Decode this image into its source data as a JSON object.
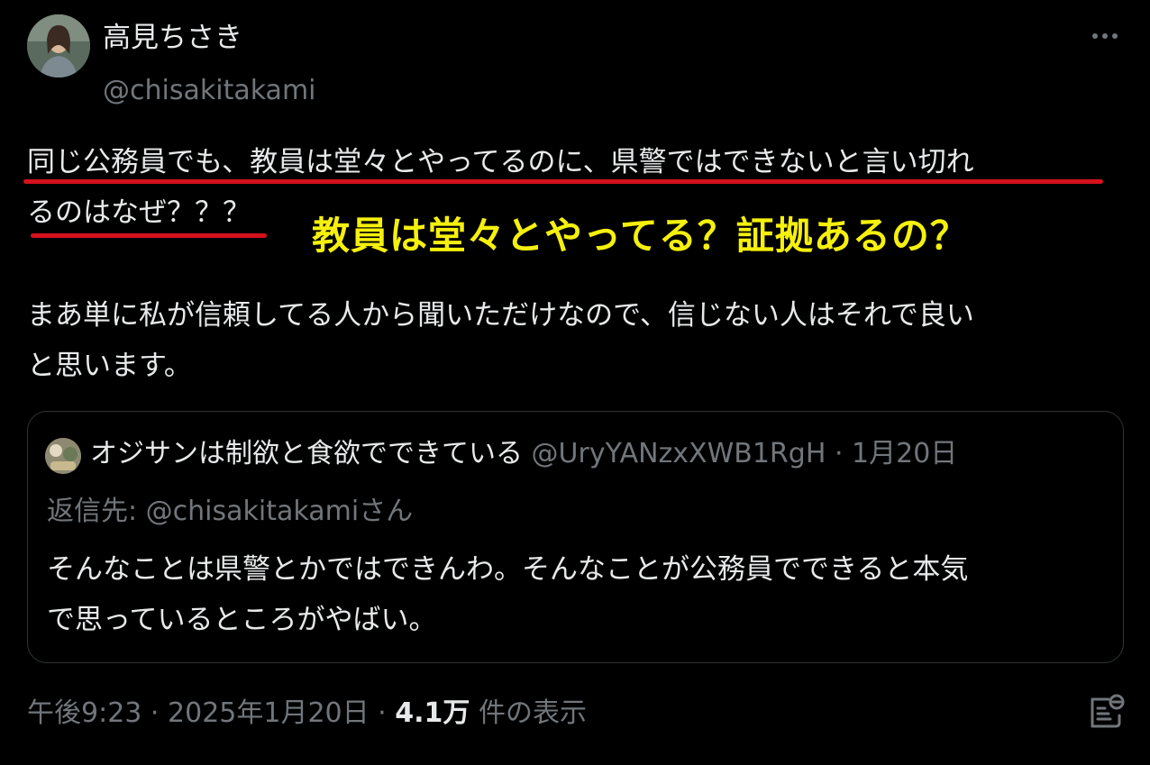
{
  "author": {
    "display_name": "高見ちさき",
    "handle": "@chisakitakami",
    "avatar_icon": "avatar-photo",
    "more_icon": "more-options-icon"
  },
  "tweet": {
    "lines": [
      "同じ公務員でも、教員は堂々とやってるのに、県警ではできないと言い切れ",
      "るのはなぜ？？？",
      "まあ単に私が信頼してる人から聞いただけなので、信じない人はそれで良い",
      "と思います。"
    ]
  },
  "annotation": {
    "text": "教員は堂々とやってる？証拠あるの？",
    "color": "#f5f00c",
    "underline_color": "#d4111d"
  },
  "quoted": {
    "display_name": "オジサンは制欲と食欲でできている",
    "handle": "@UryYANzxXWB1RgH",
    "separator": "·",
    "date": "1月20日",
    "reply_to_label": "返信先:",
    "reply_to_handle": "@chisakitakami",
    "reply_to_suffix": "さん",
    "lines": [
      "そんなことは県警とかではできんわ。そんなことが公務員でできると本気",
      "で思っているところがやばい。"
    ]
  },
  "footer": {
    "time": "午後9:23",
    "separator": "·",
    "date": "2025年1月20日",
    "views_count": "4.1万",
    "views_label": "件の表示",
    "analytics_icon": "analytics-icon"
  },
  "colors": {
    "background": "#000000",
    "text": "#e7e9ea",
    "muted": "#71767b",
    "border": "#2f3336"
  }
}
